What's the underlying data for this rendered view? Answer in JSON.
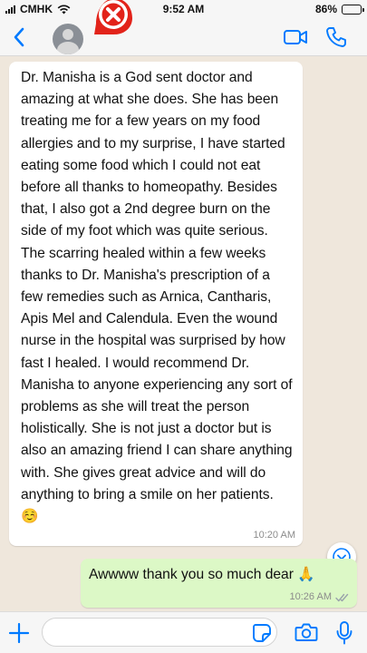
{
  "status_bar": {
    "carrier": "CMHK",
    "time": "9:52 AM",
    "battery": "86%",
    "battery_level": 0.86
  },
  "header": {
    "back_icon": "chevron-left-icon",
    "video_icon": "video-camera-icon",
    "call_icon": "phone-icon",
    "accent_color": "#007aff"
  },
  "overlay": {
    "icon": "close-x-icon",
    "color": "#e2231a"
  },
  "messages": [
    {
      "direction": "incoming",
      "text": "Dr. Manisha is a God sent doctor and amazing at what she does. She has been treating me for a few years on my food allergies and to my surprise, I have started eating some food which I could not eat before all thanks to homeopathy. Besides that, I also got a 2nd degree burn on the side of my foot which was quite serious. The scarring healed within a few weeks thanks to Dr. Manisha's prescription of a few remedies such as Arnica, Cantharis, Apis Mel and Calendula. Even the wound nurse in the hospital was surprised by how fast I healed. I would recommend Dr. Manisha to anyone experiencing any sort of problems as she will treat the person holistically. She is not just a doctor but is also an amazing friend I can share anything with. She gives great advice and will do anything to bring a smile on her patients. ☺️",
      "time": "10:20 AM"
    },
    {
      "direction": "outgoing",
      "text": "Awwww thank you so much dear 🙏",
      "time": "10:26 AM"
    }
  ],
  "composer": {
    "placeholder": "",
    "plus_icon": "plus-icon",
    "sticker_icon": "sticker-icon",
    "camera_icon": "camera-icon",
    "mic_icon": "microphone-icon"
  }
}
